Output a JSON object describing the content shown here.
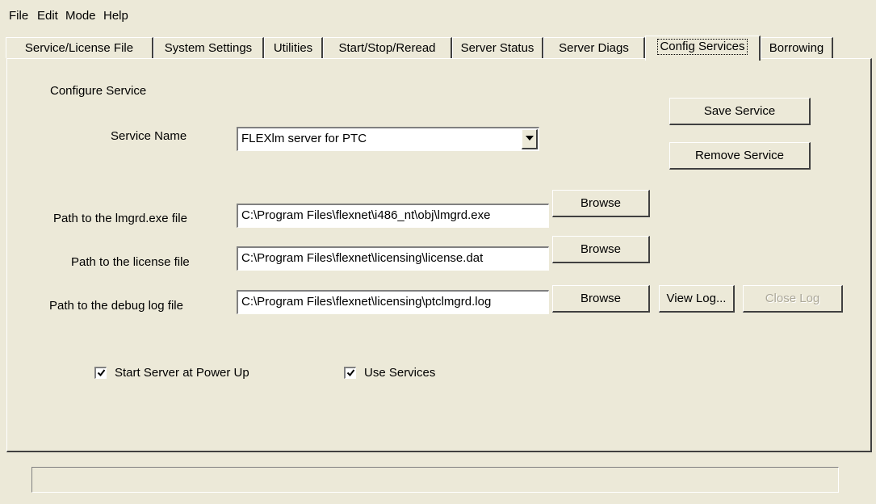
{
  "menu": {
    "items": [
      {
        "label": "File"
      },
      {
        "label": "Edit"
      },
      {
        "label": "Mode"
      },
      {
        "label": "Help"
      }
    ]
  },
  "tabs": [
    {
      "label": "Service/License File"
    },
    {
      "label": "System Settings"
    },
    {
      "label": "Utilities"
    },
    {
      "label": "Start/Stop/Reread"
    },
    {
      "label": "Server Status"
    },
    {
      "label": "Server Diags"
    },
    {
      "label": "Config Services",
      "active": true
    },
    {
      "label": "Borrowing"
    }
  ],
  "config": {
    "section_title": "Configure Service",
    "service_name_label": "Service Name",
    "service_name_value": "FLEXlm server for PTC",
    "save_service": "Save Service",
    "remove_service": "Remove Service",
    "lmgrd_label": "Path to the lmgrd.exe file",
    "lmgrd_value": "C:\\Program Files\\flexnet\\i486_nt\\obj\\lmgrd.exe",
    "license_label": "Path to the license file",
    "license_value": "C:\\Program Files\\flexnet\\licensing\\license.dat",
    "debug_label": "Path to the debug log file",
    "debug_value": "C:\\Program Files\\flexnet\\licensing\\ptclmgrd.log",
    "browse": "Browse",
    "view_log": "View Log...",
    "close_log": "Close Log",
    "start_server_label": "Start Server at Power Up",
    "start_server_checked": true,
    "use_services_label": "Use Services",
    "use_services_checked": true
  },
  "icons": {
    "dropdown": "chevron-down-icon",
    "checkmark": "checkmark-icon"
  }
}
